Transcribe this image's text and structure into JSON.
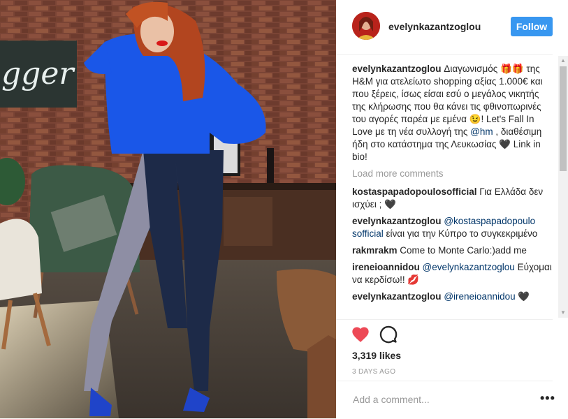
{
  "header": {
    "username": "evelynkazantzoglou",
    "follow_label": "Follow"
  },
  "photo": {
    "neon_sign_text": "gger"
  },
  "caption": {
    "username": "evelynkazantzoglou",
    "text_1": " Διαγωνισμός 🎁🎁 της H&M για ατελείωτο shopping αξίας 1.000€ και που ξέρεις, ίσως είσαι εσύ ο μεγάλος νικητής της κλήρωσης που θα κάνει τις φθινοπωρινές του αγορές παρέα με εμένα 😉! Let's Fall In Love με τη νέα συλλογή της ",
    "mention": "@hm",
    "text_2": " , διαθέσιμη ήδη στο κατάστημα της Λευκωσίας 🖤 Link in bio!"
  },
  "load_more_label": "Load more comments",
  "comments": [
    {
      "username": "kostaspapadopoulosofficial",
      "text": " Για Ελλάδα δεν ισχύει ; 🖤",
      "mention": "",
      "text_after": ""
    },
    {
      "username": "evelynkazantzoglou",
      "text": " ",
      "mention": "@kostaspapadopoulo sofficial",
      "text_after": " είναι για την Κύπρο το συγκεκριμένο"
    },
    {
      "username": "rakmrakm",
      "text": " Come to Monte Carlo:)add me",
      "mention": "",
      "text_after": ""
    },
    {
      "username": "ireneioannidou",
      "text": " ",
      "mention": "@evelynkazantzoglou",
      "text_after": " Εύχομαι να κερδίσω!! 💋"
    },
    {
      "username": "evelynkazantzoglou",
      "text": " ",
      "mention": "@ireneioannidou",
      "text_after": " 🖤"
    }
  ],
  "likes": "3,319 likes",
  "time_ago": "3 DAYS AGO",
  "add_comment_placeholder": "Add a comment...",
  "more_options_label": "•••",
  "colors": {
    "follow_button": "#3897f0",
    "heart": "#ed4956",
    "mention": "#003569"
  },
  "icons": {
    "like": "heart-icon",
    "comment": "comment-bubble-icon",
    "more": "more-options-icon"
  }
}
